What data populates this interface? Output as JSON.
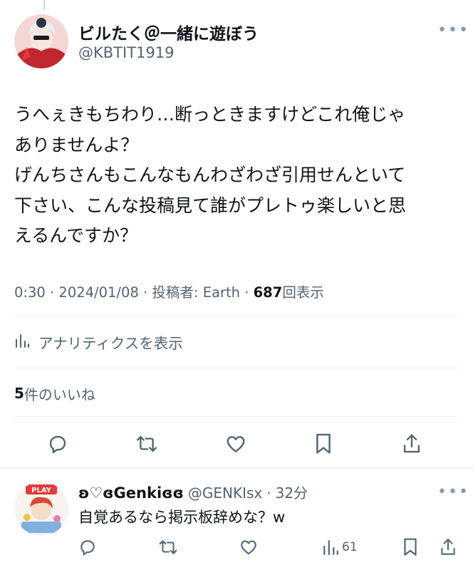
{
  "tweet": {
    "author": {
      "display_name": "ビルたく＠一緒に遊ぼう",
      "handle": "@KBTIT1919",
      "more_label": "•••"
    },
    "body_lines": [
      "うへぇきもちわり…断っときますけどこれ俺じゃ",
      "ありませんよ？",
      "げんちさんもこんなもんわざわざ引用せんといて",
      "下さい、こんな投稿見て誰がプレトゥ楽しいと思",
      "えるんですか？"
    ],
    "meta": {
      "time": "0:30",
      "date": "2024/01/08",
      "posted_by_label": "投稿者: Earth",
      "view_count": "687",
      "view_label": "回表示"
    },
    "analytics_label": "アナリティクスを表示",
    "likes": {
      "count": "5",
      "label": "件のいいね"
    },
    "actions": {
      "reply_icon": "reply-icon",
      "retweet_icon": "retweet-icon",
      "like_icon": "heart-icon",
      "bookmark_icon": "bookmark-icon",
      "share_icon": "share-icon"
    }
  },
  "reply": {
    "display_name": "ʚ♡ɞGenkiɞɞ",
    "handle": "@GENKIsx",
    "time": "32分",
    "more_label": "•••",
    "text": "自覚あるなら掲示板辞めな？w",
    "view_count": "61"
  },
  "colors": {
    "text_primary": "#0f1419",
    "text_secondary": "#536471",
    "divider": "#eff3f4"
  }
}
